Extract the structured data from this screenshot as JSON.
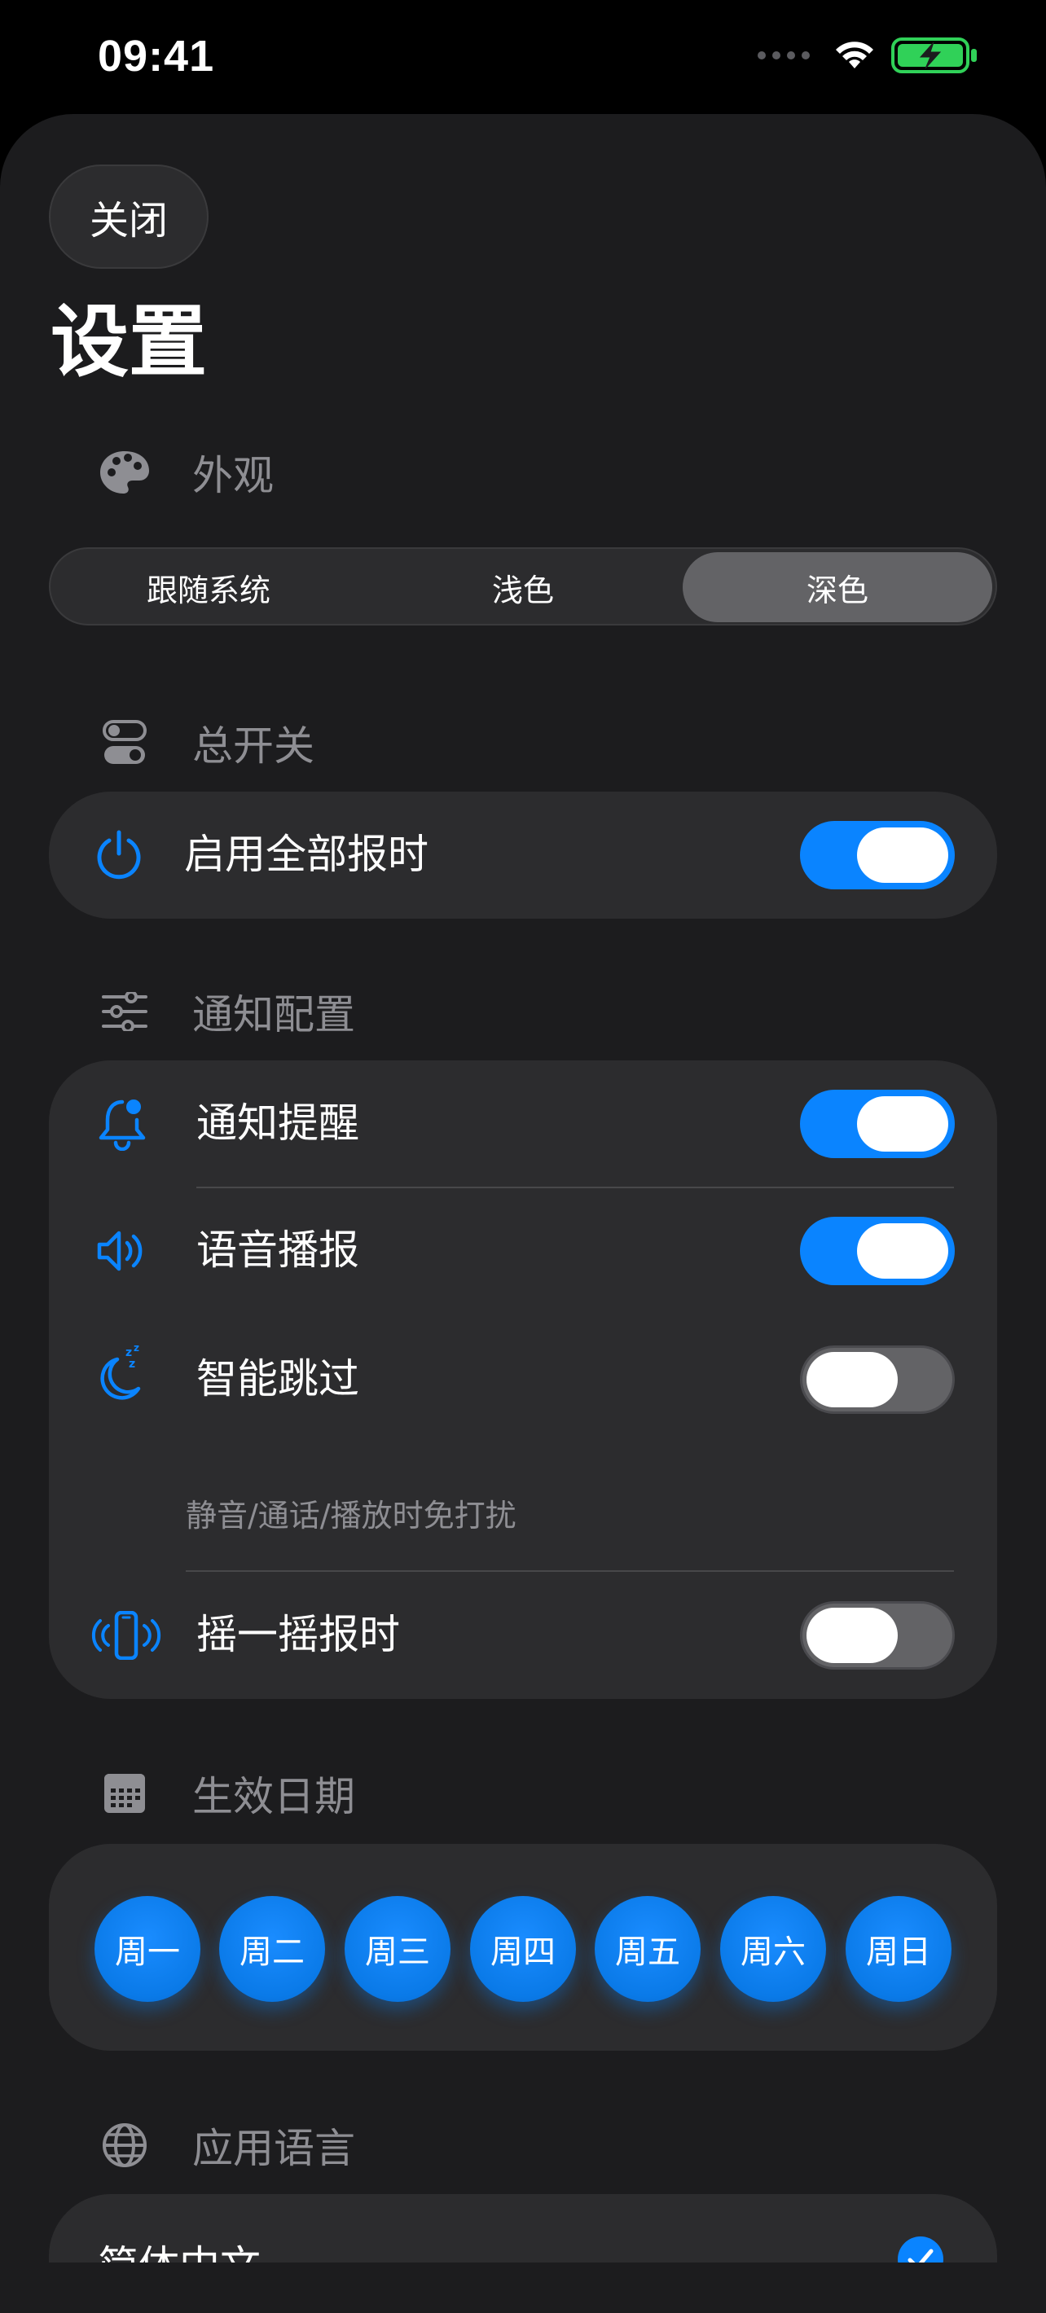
{
  "status_bar": {
    "time": "09:41"
  },
  "header": {
    "close_label": "关闭",
    "title": "设置"
  },
  "appearance": {
    "section_label": "外观",
    "icon": "palette-icon",
    "options": [
      "跟随系统",
      "浅色",
      "深色"
    ],
    "selected": "深色"
  },
  "master": {
    "section_label": "总开关",
    "icon": "toggles-icon",
    "row_label": "启用全部报时",
    "row_icon": "power-icon",
    "enabled": true
  },
  "notification": {
    "section_label": "通知配置",
    "icon": "sliders-icon",
    "rows": [
      {
        "label": "通知提醒",
        "icon": "bell-badge-icon",
        "enabled": true
      },
      {
        "label": "语音播报",
        "icon": "speaker-wave-icon",
        "enabled": true
      },
      {
        "label": "智能跳过",
        "icon": "moon-zzz-icon",
        "enabled": false,
        "subtitle": "静音/通话/播放时免打扰"
      },
      {
        "label": "摇一摇报时",
        "icon": "phone-shake-icon",
        "enabled": false
      }
    ]
  },
  "dates": {
    "section_label": "生效日期",
    "icon": "calendar-icon",
    "days": [
      "周一",
      "周二",
      "周三",
      "周四",
      "周五",
      "周六",
      "周日"
    ]
  },
  "language": {
    "section_label": "应用语言",
    "icon": "globe-icon",
    "options": [
      {
        "label": "简体中文",
        "selected": true
      }
    ]
  },
  "colors": {
    "accent": "#0a84ff",
    "background": "#1c1c1e",
    "card": "#2c2c2e",
    "secondary_text": "#8e8e93",
    "battery": "#30d158"
  }
}
